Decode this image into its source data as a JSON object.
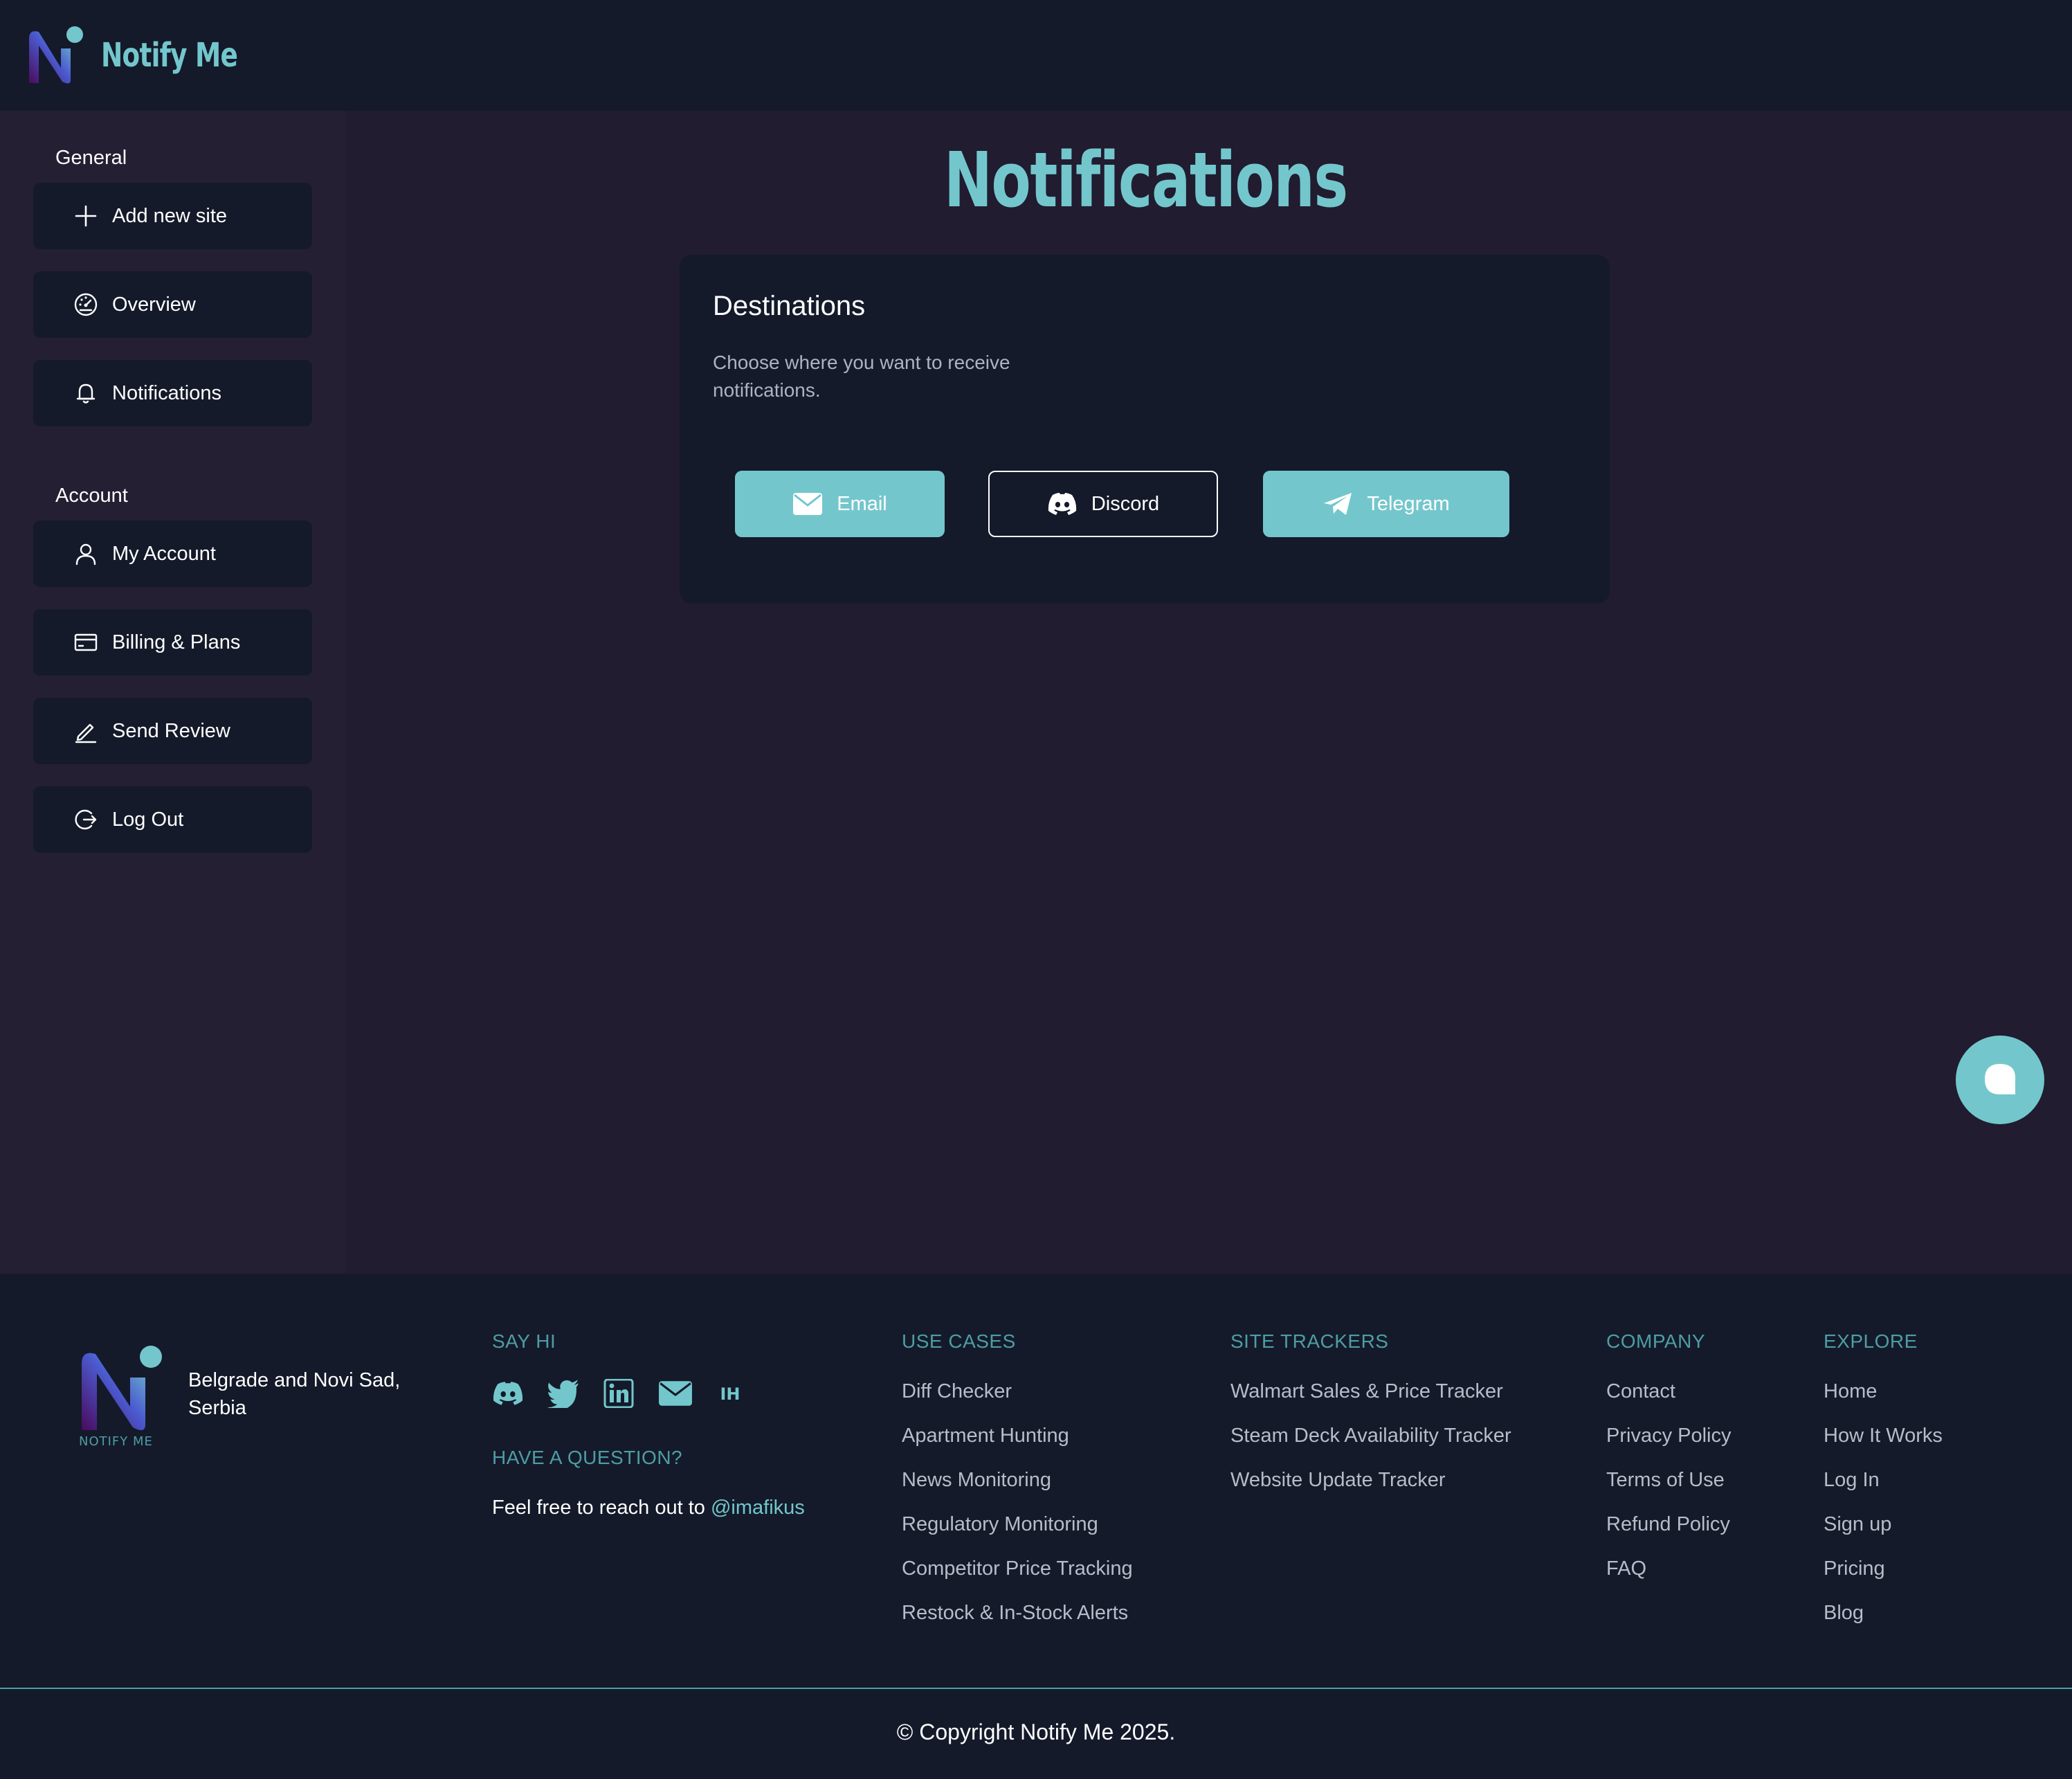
{
  "brand": {
    "name": "Notify Me",
    "footer_tagline": "NOTIFY ME"
  },
  "colors": {
    "accent": "#73c7cc",
    "background": "#211c30",
    "panel": "#141a2a"
  },
  "sidebar": {
    "sections": [
      {
        "title": "General",
        "items": [
          {
            "label": "Add new site",
            "icon": "plus-icon"
          },
          {
            "label": "Overview",
            "icon": "gauge-icon"
          },
          {
            "label": "Notifications",
            "icon": "bell-icon"
          }
        ]
      },
      {
        "title": "Account",
        "items": [
          {
            "label": "My Account",
            "icon": "user-icon"
          },
          {
            "label": "Billing & Plans",
            "icon": "credit-card-icon"
          },
          {
            "label": "Send Review",
            "icon": "pen-icon"
          },
          {
            "label": "Log Out",
            "icon": "logout-icon"
          }
        ]
      }
    ]
  },
  "main": {
    "title": "Notifications",
    "card": {
      "title": "Destinations",
      "description": "Choose where you want to receive notifications.",
      "buttons": [
        {
          "label": "Email",
          "icon": "envelope-icon"
        },
        {
          "label": "Discord",
          "icon": "discord-icon"
        },
        {
          "label": "Telegram",
          "icon": "telegram-icon"
        }
      ]
    }
  },
  "footer": {
    "address": "Belgrade and Novi Sad, Serbia",
    "say_hi": {
      "heading": "SAY HI",
      "icons": [
        "discord-icon",
        "twitter-icon",
        "linkedin-icon",
        "envelope-icon",
        "indiehackers-icon"
      ],
      "ih_text": "IH"
    },
    "question": {
      "heading": "HAVE A QUESTION?",
      "text": "Feel free to reach out to",
      "handle": "@imafikus"
    },
    "columns": [
      {
        "heading": "USE CASES",
        "links": [
          "Diff Checker",
          "Apartment Hunting",
          "News Monitoring",
          "Regulatory Monitoring",
          "Competitor Price Tracking",
          "Restock & In-Stock Alerts"
        ]
      },
      {
        "heading": "SITE TRACKERS",
        "links": [
          "Walmart Sales & Price Tracker",
          "Steam Deck Availability Tracker",
          "Website Update Tracker"
        ]
      },
      {
        "heading": "COMPANY",
        "links": [
          "Contact",
          "Privacy Policy",
          "Terms of Use",
          "Refund Policy",
          "FAQ"
        ]
      },
      {
        "heading": "EXPLORE",
        "links": [
          "Home",
          "How It Works",
          "Log In",
          "Sign up",
          "Pricing",
          "Blog"
        ]
      }
    ],
    "copyright": "© Copyright Notify Me 2025."
  }
}
